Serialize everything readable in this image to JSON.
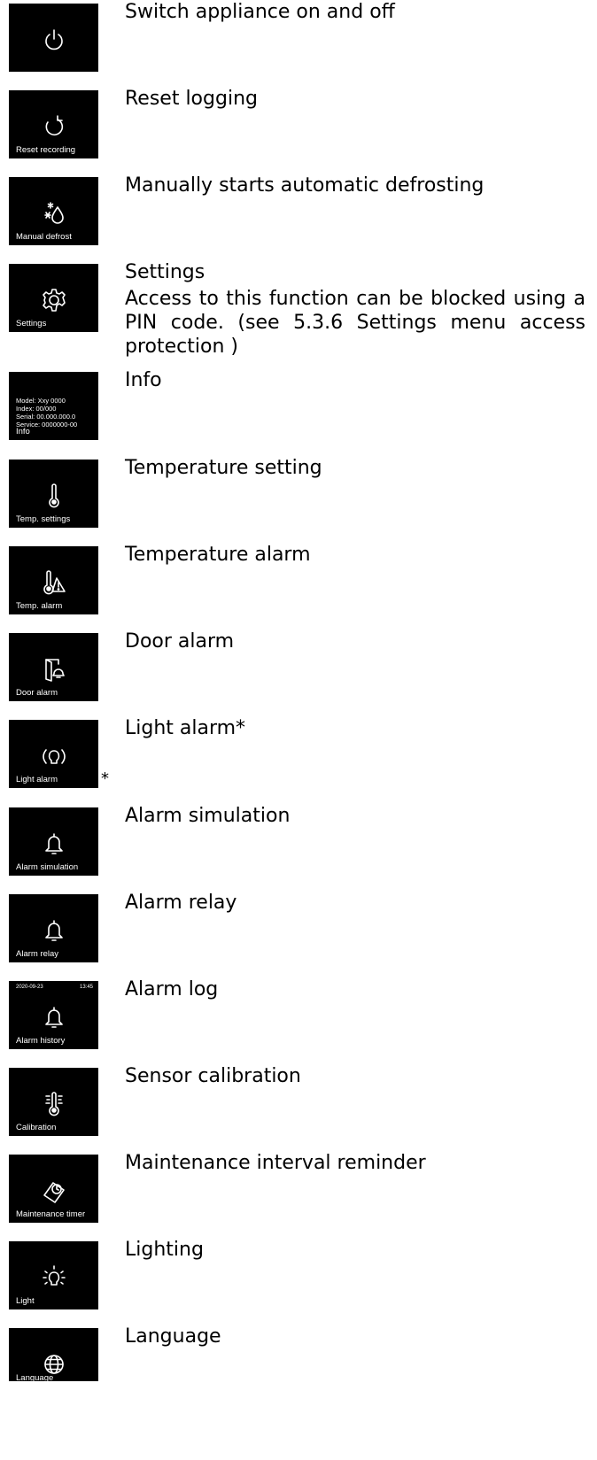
{
  "rows": [
    {
      "icon": "power-icon",
      "caption": "",
      "text": "Switch appliance on and off"
    },
    {
      "icon": "reset-icon",
      "caption": "Reset recording",
      "text": "Reset logging"
    },
    {
      "icon": "defrost-icon",
      "caption": "Manual defrost",
      "text": "Manually starts automatic defrosting"
    },
    {
      "icon": "gear-icon",
      "caption": "Settings",
      "text": "Settings",
      "subtext": "Access to this function can be blocked using a PIN code. (see 5.3.6 Settings menu access protection )"
    },
    {
      "icon": "info-screen",
      "caption": "Info",
      "text": "Info",
      "info_lines": [
        "Model: Xxy 0000",
        "Index: 00/000",
        "Serial: 00.000.000.0",
        "Service: 0000000-00"
      ]
    },
    {
      "icon": "thermometer-icon",
      "caption": "Temp. settings",
      "text": "Temperature setting"
    },
    {
      "icon": "temp-alarm-icon",
      "caption": "Temp. alarm",
      "text": "Temperature alarm"
    },
    {
      "icon": "door-alarm-icon",
      "caption": "Door alarm",
      "text": "Door alarm"
    },
    {
      "icon": "light-alarm-icon",
      "caption": "Light alarm",
      "text": "Light alarm*",
      "marker": "*"
    },
    {
      "icon": "bell-icon",
      "caption": "Alarm simulation",
      "text": "Alarm simulation"
    },
    {
      "icon": "bell-icon",
      "caption": "Alarm relay",
      "text": "Alarm relay"
    },
    {
      "icon": "bell-icon",
      "caption": "Alarm history",
      "text": "Alarm log",
      "date": "2020-09-23",
      "time": "13:45"
    },
    {
      "icon": "calibration-icon",
      "caption": "Calibration",
      "text": "Sensor calibration"
    },
    {
      "icon": "maintenance-icon",
      "caption": "Maintenance timer",
      "text": "Maintenance interval reminder"
    },
    {
      "icon": "lightbulb-icon",
      "caption": "Light",
      "text": "Lighting"
    },
    {
      "icon": "globe-icon",
      "caption": "Language",
      "text": "Language"
    }
  ]
}
